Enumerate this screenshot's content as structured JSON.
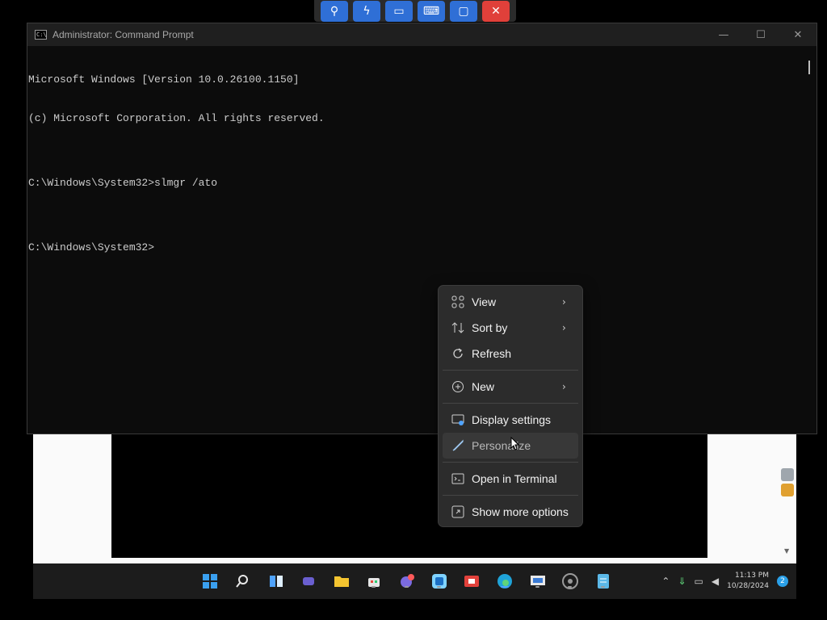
{
  "remote_toolbar": {
    "buttons": [
      "pin-icon",
      "lightning-icon",
      "monitor-icon",
      "keyboard-icon",
      "chat-icon",
      "close-icon"
    ]
  },
  "cmd": {
    "title": "Administrator: Command Prompt",
    "icon_text": "C:\\",
    "lines": [
      "Microsoft Windows [Version 10.0.26100.1150]",
      "(c) Microsoft Corporation. All rights reserved.",
      "",
      "C:\\Windows\\System32>slmgr /ato",
      "",
      "C:\\Windows\\System32>"
    ]
  },
  "context_menu": {
    "items": [
      {
        "label": "View",
        "icon": "grid-icon",
        "submenu": true
      },
      {
        "label": "Sort by",
        "icon": "sort-icon",
        "submenu": true
      },
      {
        "label": "Refresh",
        "icon": "refresh-icon",
        "submenu": false
      },
      {
        "label": "New",
        "icon": "plus-circle-icon",
        "submenu": true
      },
      {
        "label": "Display settings",
        "icon": "display-icon",
        "submenu": false
      },
      {
        "label": "Personalize",
        "icon": "brush-icon",
        "submenu": false
      },
      {
        "label": "Open in Terminal",
        "icon": "terminal-icon",
        "submenu": false
      },
      {
        "label": "Show more options",
        "icon": "more-options-icon",
        "submenu": false
      }
    ]
  },
  "taskbar": {
    "clock_time": "11:13 PM",
    "clock_date": "10/28/2024",
    "notification_count": "2"
  },
  "colors": {
    "accent": "#2f6fd6",
    "terminal_bg": "#0c0c0c",
    "menu_bg": "#2c2c2c"
  }
}
